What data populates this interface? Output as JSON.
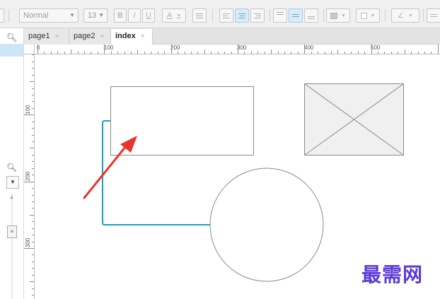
{
  "toolbar": {
    "font_style": "Normal",
    "font_size": "13",
    "bold_label": "B",
    "italic_label": "I",
    "underline_label": "U",
    "font_color_label": "A"
  },
  "tabs": [
    {
      "label": "page1",
      "close": "×",
      "active": false
    },
    {
      "label": "page2",
      "close": "×",
      "active": false
    },
    {
      "label": "index",
      "close": "×",
      "active": true
    }
  ],
  "ruler": {
    "horizontal_labels": [
      "0",
      "100",
      "200",
      "300",
      "400",
      "500"
    ],
    "vertical_labels": [
      "100",
      "200",
      "300"
    ]
  },
  "canvas": {
    "shapes": [
      "rectangle",
      "image-placeholder",
      "circle",
      "connector",
      "arrow"
    ],
    "connector_color": "#1aa0c0",
    "arrow_color": "#e8342a"
  },
  "watermark": "最需网",
  "colors": {
    "toolbar_bg": "#f0f0f0",
    "active_tab_bg": "#ffffff",
    "selection_blue": "#cde6f7",
    "watermark": "#5b3ad8"
  }
}
